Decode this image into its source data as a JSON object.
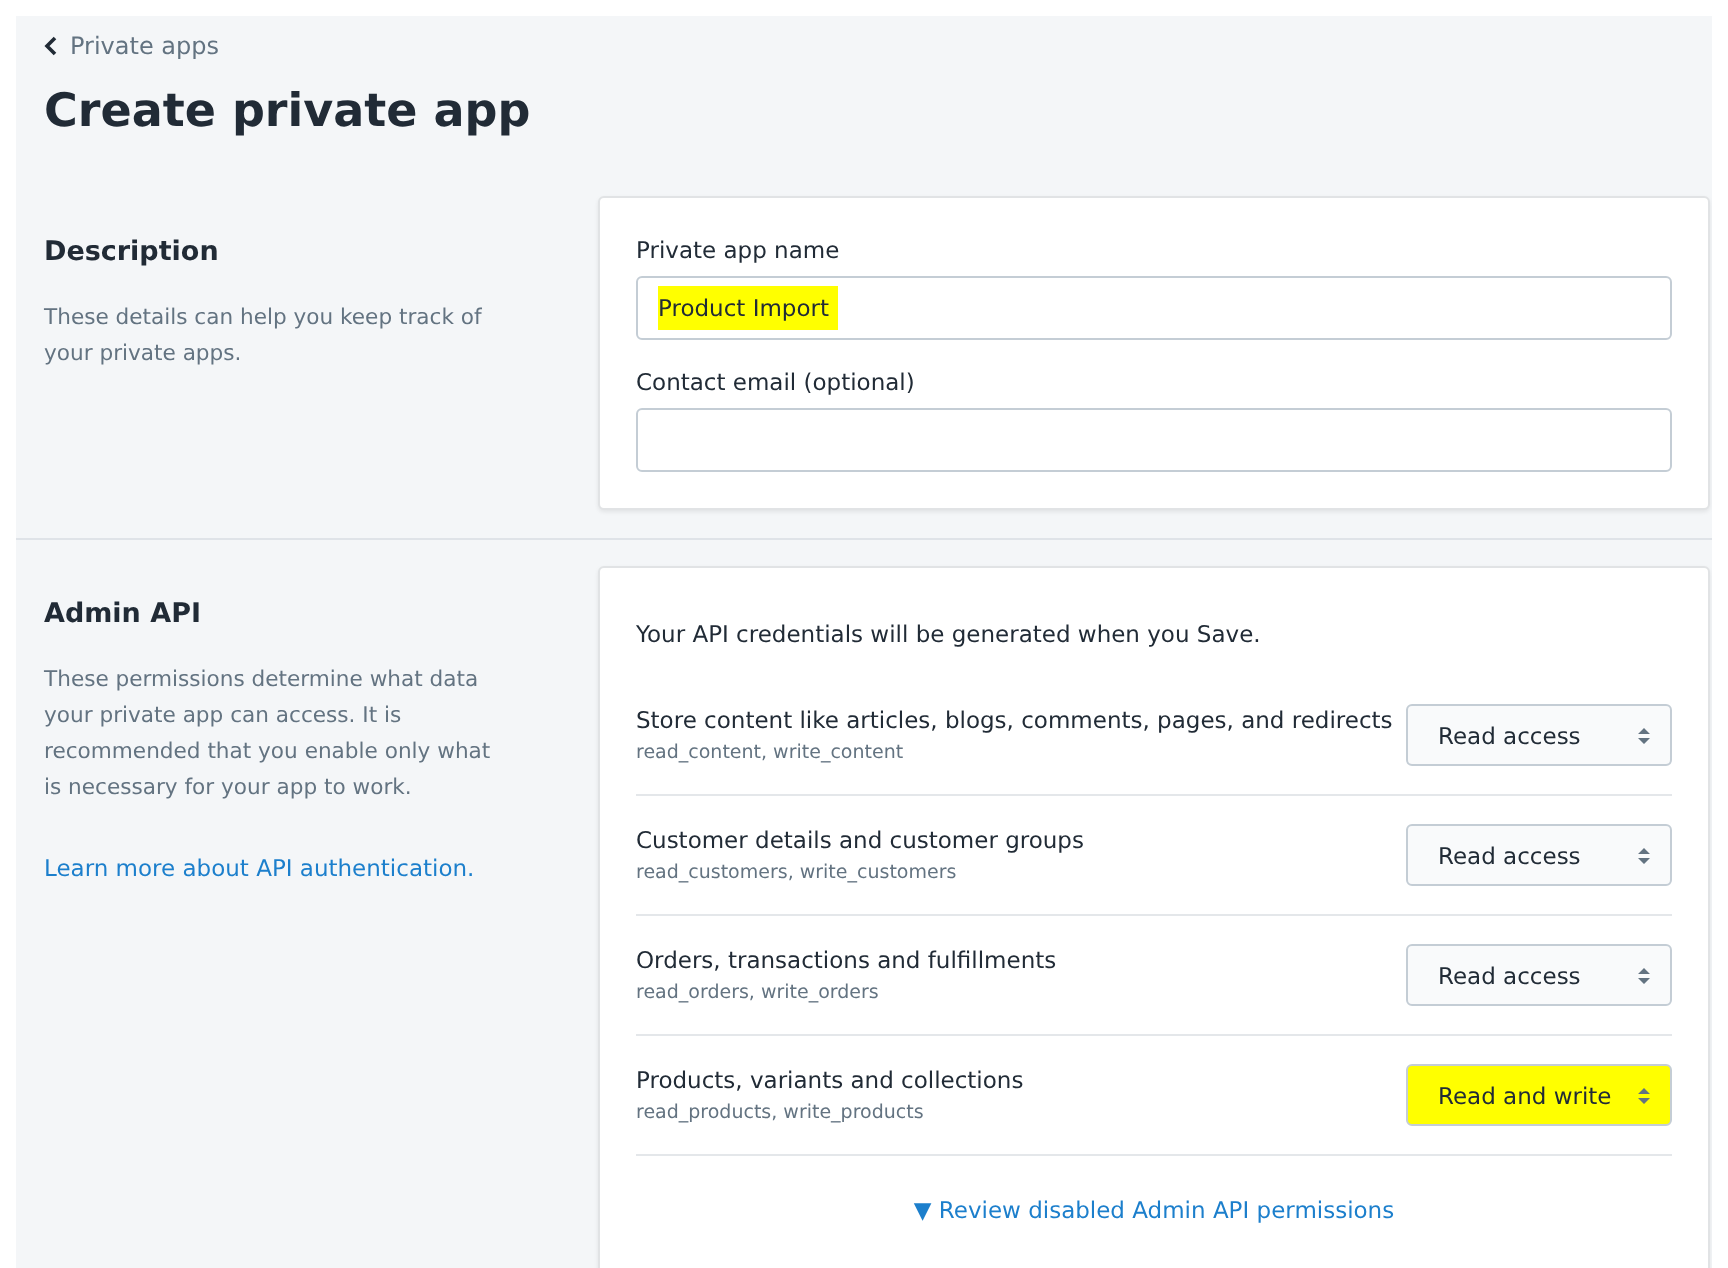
{
  "breadcrumb": {
    "label": "Private apps"
  },
  "title": "Create private app",
  "description_section": {
    "heading": "Description",
    "text": "These details can help you keep track of your private apps.",
    "fields": [
      {
        "label": "Private app name",
        "value": "Product Import",
        "highlighted": true
      },
      {
        "label": "Contact email (optional)"
      }
    ]
  },
  "admin_api_section": {
    "heading": "Admin API",
    "text": "These permissions determine what data your private app can access. It is recommended that you enable only what is necessary for your app to work.",
    "link": "Learn more about API authentication.",
    "notice": "Your API credentials will be generated when you Save.",
    "permissions": [
      {
        "title": "Store content like articles, blogs, comments, pages, and redirects",
        "scopes": "read_content, write_content",
        "access": "Read access",
        "highlighted": false
      },
      {
        "title": "Customer details and customer groups",
        "scopes": "read_customers, write_customers",
        "access": "Read access",
        "highlighted": false
      },
      {
        "title": "Orders, transactions and fulfillments",
        "scopes": "read_orders, write_orders",
        "access": "Read access",
        "highlighted": false
      },
      {
        "title": "Products, variants and collections",
        "scopes": "read_products, write_products",
        "access": "Read and write",
        "highlighted": true
      }
    ],
    "review_link": "▼ Review disabled Admin API permissions"
  }
}
